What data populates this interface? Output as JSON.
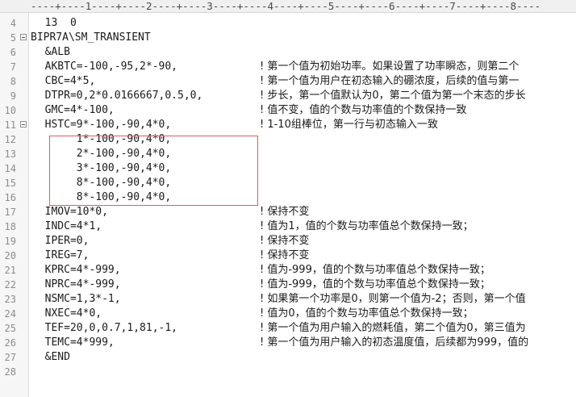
{
  "ruler": "----+----1----+----2----+----3----+----4----+----5----+----6----+----7----+----8----",
  "lines": [
    {
      "n": "4",
      "code": "  13  0",
      "comment": "",
      "fold": false
    },
    {
      "n": "5",
      "code": "BIPR7A\\SM_TRANSIENT",
      "comment": "",
      "fold": true
    },
    {
      "n": "6",
      "code": "  &ALB",
      "comment": "",
      "fold": false
    },
    {
      "n": "7",
      "code": "  AKBTC=-100,-95,2*-90,",
      "comment": "! 第一个值为初始功率。如果设置了功率瞬态，则第二个",
      "fold": false
    },
    {
      "n": "8",
      "code": "  CBC=4*5,",
      "comment": "! 第一个值为用户在初态输入的硼浓度，后续的值与第一",
      "fold": false
    },
    {
      "n": "9",
      "code": "  DTPR=0,2*0.0166667,0.5,0,",
      "comment": "! 步长，第一个值默认为0，第二个值为第一个末态的步长",
      "fold": false
    },
    {
      "n": "10",
      "code": "  GMC=4*-100,",
      "comment": "! 值不变，值的个数与功率值的个数保持一致",
      "fold": false
    },
    {
      "n": "11",
      "code": "  HSTC=9*-100,-90,4*0,",
      "comment": "! 1-10组棒位，第一行与初态输入一致",
      "fold": true
    },
    {
      "n": "12",
      "code": "       1*-100,-90,4*0,",
      "comment": "",
      "fold": false
    },
    {
      "n": "13",
      "code": "       2*-100,-90,4*0,",
      "comment": "",
      "fold": false
    },
    {
      "n": "14",
      "code": "       3*-100,-90,4*0,",
      "comment": "",
      "fold": false
    },
    {
      "n": "15",
      "code": "       8*-100,-90,4*0,",
      "comment": "",
      "fold": false
    },
    {
      "n": "16",
      "code": "       8*-100,-90,4*0,",
      "comment": "",
      "fold": false
    },
    {
      "n": "17",
      "code": "  IMOV=10*0,",
      "comment": "! 保持不变",
      "fold": false
    },
    {
      "n": "18",
      "code": "  INDC=4*1,",
      "comment": "! 值为1，值的个数与功率值总个数保持一致；",
      "fold": false
    },
    {
      "n": "19",
      "code": "  IPER=0,",
      "comment": "! 保持不变",
      "fold": false
    },
    {
      "n": "20",
      "code": "  IREG=7,",
      "comment": "! 保持不变",
      "fold": false
    },
    {
      "n": "21",
      "code": "  KPRC=4*-999,",
      "comment": "! 值为-999，值的个数与功率值总个数保持一致；",
      "fold": false
    },
    {
      "n": "22",
      "code": "  NPRC=4*-999,",
      "comment": "! 值为-999，值的个数与功率值总个数保持一致；",
      "fold": false
    },
    {
      "n": "23",
      "code": "  NSMC=1,3*-1,",
      "comment": "! 如果第一个功率是0，则第一个值为-2；否则，第一个值",
      "fold": false
    },
    {
      "n": "24",
      "code": "  NXEC=4*0,",
      "comment": "! 值为0，值的个数与功率值总个数保持一致；",
      "fold": false
    },
    {
      "n": "25",
      "code": "  TEF=20,0,0.7,1,81,-1,",
      "comment": "! 第一个值为用户输入的燃耗值，第二个值为0，第三值为",
      "fold": false
    },
    {
      "n": "26",
      "code": "  TEMC=4*999,",
      "comment": "! 第一个值为用户输入的初态温度值，后续都为999，值的",
      "fold": false
    },
    {
      "n": "27",
      "code": "  &END",
      "comment": "",
      "fold": false
    },
    {
      "n": "28",
      "code": "",
      "comment": "",
      "fold": false
    }
  ]
}
